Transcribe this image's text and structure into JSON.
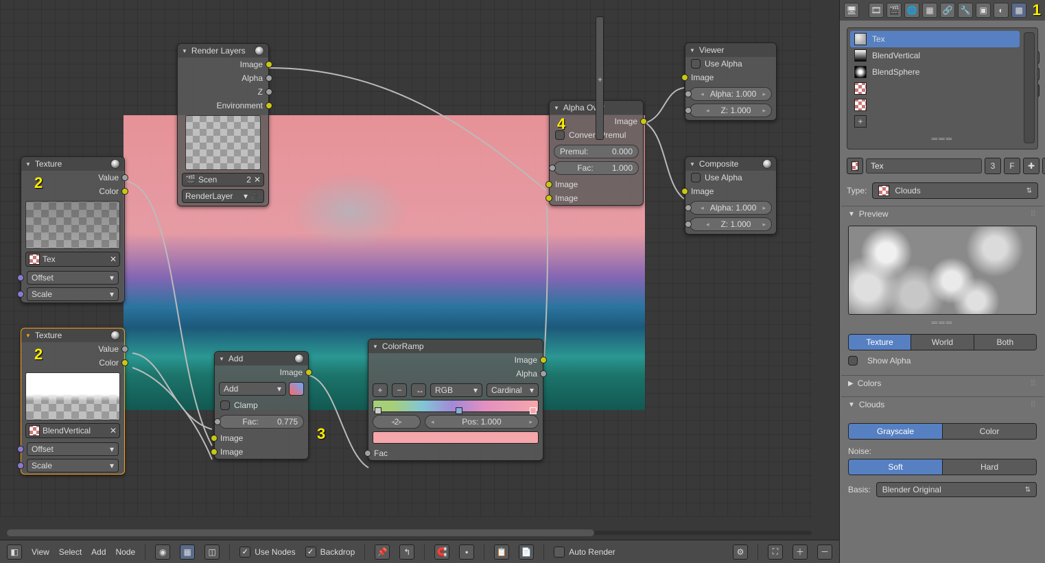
{
  "marks": {
    "m1": "1",
    "m2a": "2",
    "m2b": "2",
    "m3": "3",
    "m4": "4"
  },
  "backdrop_cutoff": "ne",
  "nodes": {
    "renderlayers": {
      "title": "Render Layers",
      "outs": {
        "image": "Image",
        "alpha": "Alpha",
        "z": "Z",
        "env": "Environment"
      },
      "scene_label": "Scen",
      "scene_users": "2",
      "layer_label": "RenderLayer"
    },
    "tex1": {
      "title": "Texture",
      "outs": {
        "value": "Value",
        "color": "Color"
      },
      "tex_name": "Tex",
      "ins": {
        "offset": "Offset",
        "scale": "Scale"
      }
    },
    "tex2": {
      "title": "Texture",
      "outs": {
        "value": "Value",
        "color": "Color"
      },
      "tex_name": "BlendVertical",
      "ins": {
        "offset": "Offset",
        "scale": "Scale"
      }
    },
    "add": {
      "title": "Add",
      "out_image": "Image",
      "mode": "Add",
      "clamp": "Clamp",
      "fac_label": "Fac:",
      "fac_val": "0.775",
      "in_image1": "Image",
      "in_image2": "Image"
    },
    "colorramp": {
      "title": "ColorRamp",
      "out_image": "Image",
      "out_alpha": "Alpha",
      "btn_plus": "+",
      "btn_minus": "−",
      "btn_flip": "↔",
      "mode1": "RGB",
      "mode2": "Cardinal",
      "idx_val": "2",
      "pos_label": "Pos:",
      "pos_val": "1.000",
      "in_fac": "Fac"
    },
    "alphaover": {
      "title": "Alpha Over",
      "out_image": "Image",
      "conv": "Convert Premul",
      "premul_label": "Premul:",
      "premul_val": "0.000",
      "fac_label": "Fac:",
      "fac_val": "1.000",
      "in_image1": "Image",
      "in_image2": "Image"
    },
    "viewer": {
      "title": "Viewer",
      "use_alpha": "Use Alpha",
      "in_image": "Image",
      "alpha_label": "Alpha:",
      "alpha_val": "1.000",
      "z_label": "Z:",
      "z_val": "1.000"
    },
    "composite": {
      "title": "Composite",
      "use_alpha": "Use Alpha",
      "in_image": "Image",
      "alpha_label": "Alpha:",
      "alpha_val": "1.000",
      "z_label": "Z:",
      "z_val": "1.000"
    }
  },
  "panel": {
    "list": {
      "i0": "Tex",
      "i1": "BlendVertical",
      "i2": "BlendSphere"
    },
    "name_field": "Tex",
    "name_users": "3",
    "name_fake": "F",
    "type_label": "Type:",
    "type_value": "Clouds",
    "sec_preview": "Preview",
    "preview_tabs": {
      "a": "Texture",
      "b": "World",
      "c": "Both"
    },
    "show_alpha": "Show Alpha",
    "sec_colors": "Colors",
    "sec_clouds": "Clouds",
    "clouds_tone": {
      "a": "Grayscale",
      "b": "Color"
    },
    "noise_label": "Noise:",
    "noise_soft": {
      "a": "Soft",
      "b": "Hard"
    },
    "basis_label": "Basis:",
    "basis_value": "Blender Original"
  },
  "bottombar": {
    "view": "View",
    "select": "Select",
    "add": "Add",
    "node": "Node",
    "use_nodes": "Use Nodes",
    "backdrop": "Backdrop",
    "auto_render": "Auto Render"
  }
}
